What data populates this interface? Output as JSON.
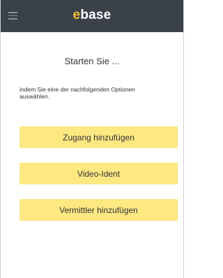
{
  "header": {
    "logo": {
      "accent": "e",
      "rest": "base"
    },
    "menu_icon": "hamburger-menu-icon",
    "background_color": "#3a4149",
    "accent_color": "#f2c12e"
  },
  "main": {
    "title": "Starten Sie ...",
    "intro": "indem Sie eine der nachfolgenden Optionen auswählen.",
    "options": [
      {
        "label": "Zugang hinzufügen"
      },
      {
        "label": "Video-Ident"
      },
      {
        "label": "Vermittler hinzufügen"
      }
    ],
    "button_color": "#fde882"
  }
}
